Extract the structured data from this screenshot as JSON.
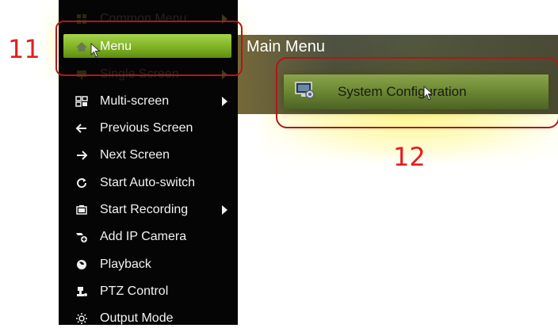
{
  "annotations": {
    "step_11": "11",
    "step_12": "12",
    "accent_color": "#e41e1e"
  },
  "context_menu": {
    "items": [
      {
        "label": "Common Menu",
        "icon": "common-menu-icon",
        "has_submenu": true
      },
      {
        "label": "Menu",
        "icon": "home-icon",
        "has_submenu": false,
        "selected": true
      },
      {
        "label": "Single Screen",
        "icon": "single-screen-icon",
        "has_submenu": true
      },
      {
        "label": "Multi-screen",
        "icon": "multi-screen-icon",
        "has_submenu": true
      },
      {
        "label": "Previous Screen",
        "icon": "arrow-left-icon",
        "has_submenu": false
      },
      {
        "label": "Next Screen",
        "icon": "arrow-right-icon",
        "has_submenu": false
      },
      {
        "label": "Start Auto-switch",
        "icon": "refresh-icon",
        "has_submenu": false
      },
      {
        "label": "Start Recording",
        "icon": "record-icon",
        "has_submenu": true
      },
      {
        "label": "Add IP Camera",
        "icon": "add-camera-icon",
        "has_submenu": false
      },
      {
        "label": "Playback",
        "icon": "playback-icon",
        "has_submenu": false
      },
      {
        "label": "PTZ Control",
        "icon": "ptz-icon",
        "has_submenu": false
      },
      {
        "label": "Output Mode",
        "icon": "output-mode-icon",
        "has_submenu": false
      }
    ],
    "highlight_color": "#7fb224"
  },
  "main_menu": {
    "title": "Main Menu",
    "items": [
      {
        "label": "System Configuration",
        "icon": "system-config-icon"
      }
    ]
  }
}
